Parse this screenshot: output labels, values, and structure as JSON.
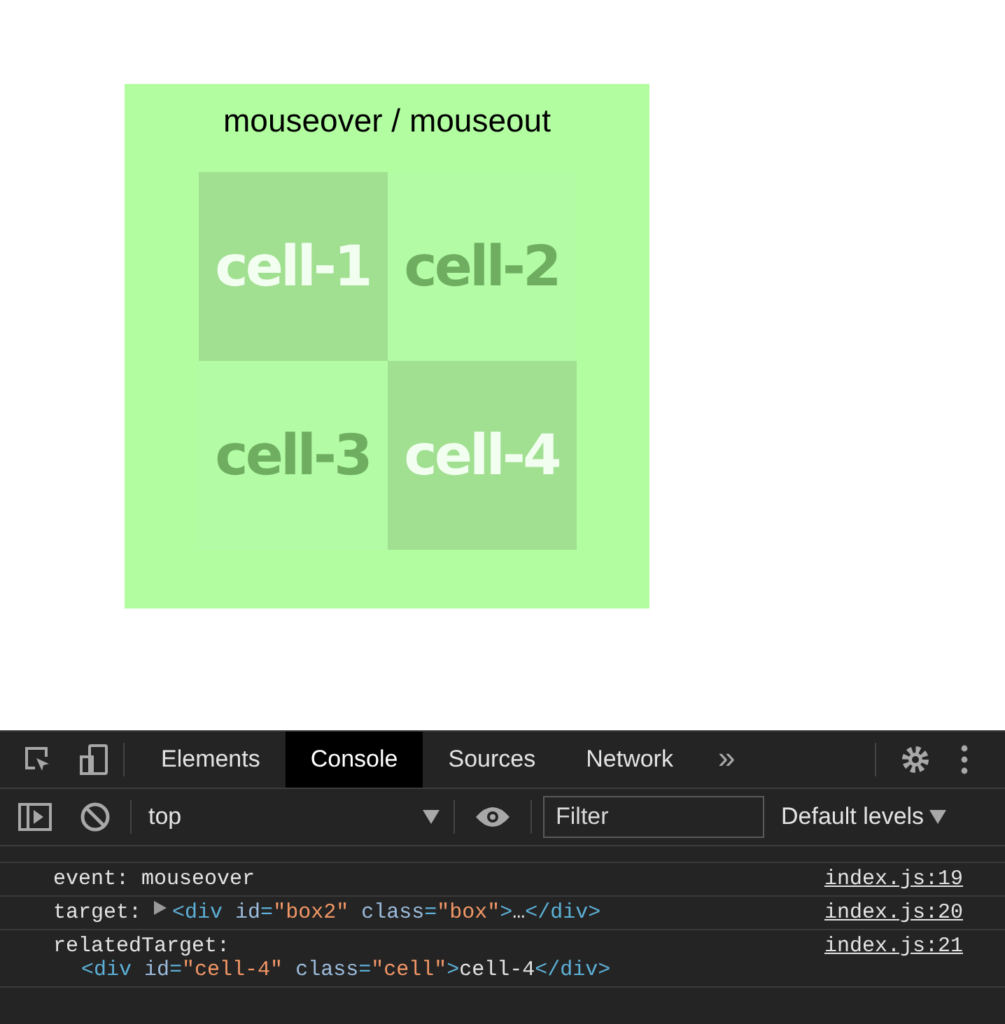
{
  "demo": {
    "title": "mouseover / mouseout",
    "cells": [
      {
        "label": "cell-1",
        "highlighted": true
      },
      {
        "label": "cell-2",
        "highlighted": false
      },
      {
        "label": "cell-3",
        "highlighted": false
      },
      {
        "label": "cell-4",
        "highlighted": true
      }
    ]
  },
  "devtools": {
    "tabs": [
      {
        "label": "Elements",
        "selected": false
      },
      {
        "label": "Console",
        "selected": true
      },
      {
        "label": "Sources",
        "selected": false
      },
      {
        "label": "Network",
        "selected": false
      }
    ],
    "more_tabs": "»",
    "context": "top",
    "filter": {
      "placeholder": "Filter"
    },
    "levels": "Default levels",
    "messages": [
      {
        "label": "event: mouseover",
        "expandable": false,
        "source": "index.js:19"
      },
      {
        "label": "target: ",
        "expandable": true,
        "wrap": false,
        "node": [
          {
            "kind": "tag",
            "text": "<div "
          },
          {
            "kind": "attr",
            "text": "id"
          },
          {
            "kind": "tag",
            "text": "="
          },
          {
            "kind": "value",
            "text": "\"box2\""
          },
          {
            "kind": "attr",
            "text": " class"
          },
          {
            "kind": "tag",
            "text": "="
          },
          {
            "kind": "value",
            "text": "\"box\""
          },
          {
            "kind": "tag",
            "text": ">"
          },
          {
            "kind": "plain",
            "text": "…"
          },
          {
            "kind": "tag",
            "text": "</div>"
          }
        ],
        "source": "index.js:20"
      },
      {
        "label": "relatedTarget:",
        "expandable": false,
        "wrap": true,
        "node": [
          {
            "kind": "tag",
            "text": "<div "
          },
          {
            "kind": "attr",
            "text": "id"
          },
          {
            "kind": "tag",
            "text": "="
          },
          {
            "kind": "value",
            "text": "\"cell-4\""
          },
          {
            "kind": "attr",
            "text": " class"
          },
          {
            "kind": "tag",
            "text": "="
          },
          {
            "kind": "value",
            "text": "\"cell\""
          },
          {
            "kind": "tag",
            "text": ">"
          },
          {
            "kind": "plain",
            "text": "cell-4"
          },
          {
            "kind": "tag",
            "text": "</div>"
          }
        ],
        "source": "index.js:21"
      }
    ]
  }
}
